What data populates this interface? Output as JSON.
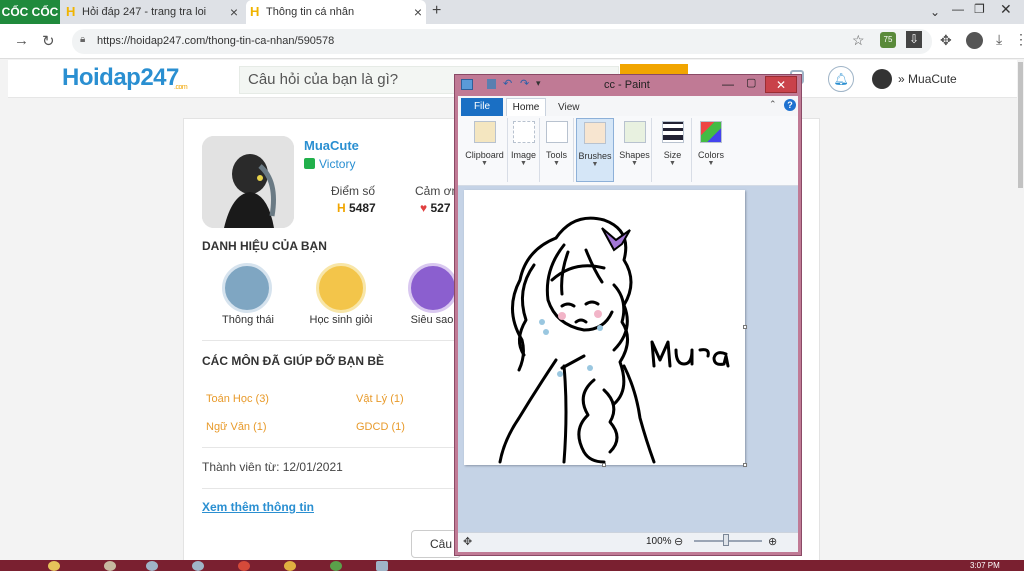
{
  "browser": {
    "brand": "CỐC CỐC",
    "tabs": [
      {
        "label": "Hỏi đáp 247 - trang tra loi"
      },
      {
        "label": "Thông tin cá nhân"
      }
    ],
    "new_tab": "+",
    "url": "https://hoidap247.com/thong-tin-ca-nhan/590578",
    "ext_badge": "75"
  },
  "site": {
    "logo": "Hoidap247",
    "logo_sub": ".com",
    "search_placeholder": "Câu hỏi của bạn là gì?",
    "header_username": "MuaCute"
  },
  "profile": {
    "name": "MuaCute",
    "rank": "Victory",
    "score_label": "Điểm số",
    "score_value": "5487",
    "thanks_label": "Cảm ơn",
    "thanks_value": "527",
    "titles_heading": "DANH HIỆU CỦA BẠN",
    "badges": [
      {
        "label": "Thông thái",
        "color": "#7fa6c2"
      },
      {
        "label": "Học sinh giỏi",
        "color": "#f3c54a"
      },
      {
        "label": "Siêu sao",
        "color": "#8b5fcf"
      }
    ],
    "subjects_heading": "CÁC MÔN ĐÃ GIÚP ĐỠ BẠN BÈ",
    "subjects": [
      "Toán Học (3)",
      "Vật Lý (1)",
      "Ngữ Văn (1)",
      "GDCD (1)"
    ],
    "member_since": "Thành viên từ: 12/01/2021",
    "see_more": "Xem thêm thông tin",
    "ask_button": "Câu"
  },
  "paint": {
    "title": "cc - Paint",
    "tabs": {
      "file": "File",
      "home": "Home",
      "view": "View"
    },
    "ribbon": [
      "Clipboard",
      "Image",
      "Tools",
      "Brushes",
      "Shapes",
      "Size",
      "Colors"
    ],
    "zoom": "100%",
    "canvas_text": "Mưa"
  },
  "taskbar": {
    "clock": "3:07 PM"
  },
  "colors": {
    "brand_blue": "#2a8fd1",
    "brand_orange": "#f1a500",
    "paint_frame": "#c07a95"
  }
}
